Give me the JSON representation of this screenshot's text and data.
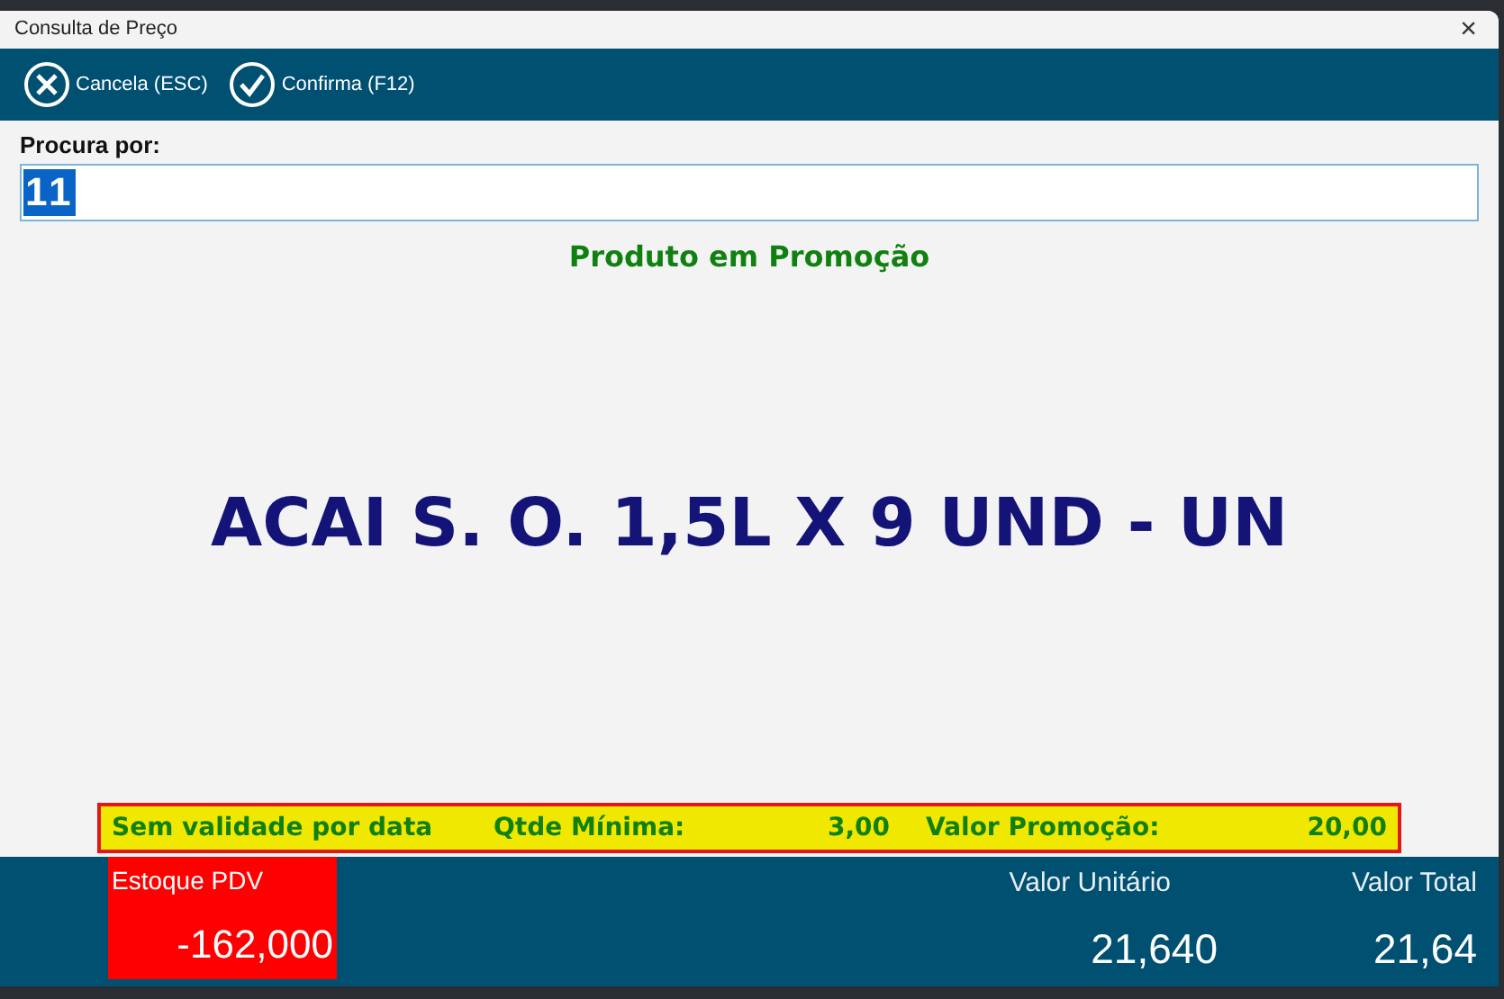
{
  "window": {
    "title": "Consulta de Preço",
    "close": "×"
  },
  "toolbar": [
    {
      "kind": "cancel",
      "label": "Cancela (ESC)"
    },
    {
      "kind": "confirm",
      "label": "Confirma (F12)"
    }
  ],
  "search": {
    "label": "Procura por:",
    "value": "11"
  },
  "status": "Produto em Promoção",
  "product": "ACAI S. O. 1,5L X 9 UND - UN",
  "promotion": {
    "validity": "Sem validade por data",
    "min_qty_label": "Qtde Mínima:",
    "min_qty": "3,00",
    "price_label": "Valor Promoção:",
    "price": "20,00"
  },
  "footer": {
    "stock_label": "Estoque PDV",
    "stock": "-162,000",
    "unit_label": "Valor Unitário",
    "unit": "21,640",
    "total_label": "Valor Total",
    "total": "21,64"
  }
}
